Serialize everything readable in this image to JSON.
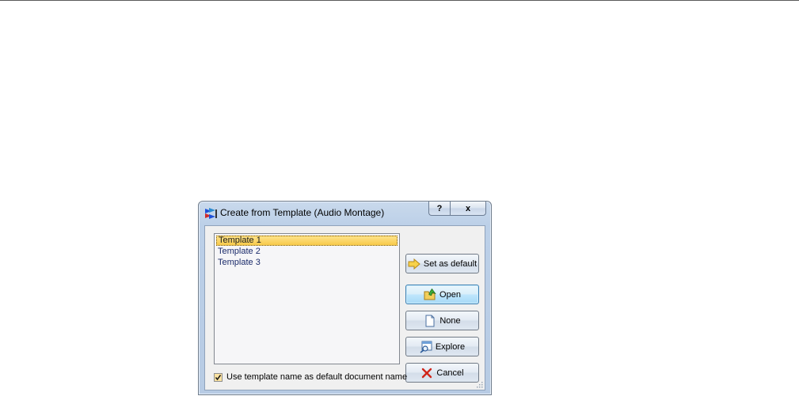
{
  "dialog": {
    "title": "Create from Template (Audio Montage)",
    "help_glyph": "?",
    "close_glyph": "x"
  },
  "templates": {
    "items": [
      "Template 1",
      "Template 2",
      "Template 3"
    ],
    "selected_index": 0
  },
  "buttons": {
    "set_default": "Set as default",
    "open": "Open",
    "none": "None",
    "explore": "Explore",
    "cancel": "Cancel"
  },
  "option": {
    "label": "Use template name as default document name",
    "checked": true
  },
  "colors": {
    "selection": "#f7c94a",
    "default_button": "#bee6fd",
    "cancel_x": "#d0261a"
  }
}
